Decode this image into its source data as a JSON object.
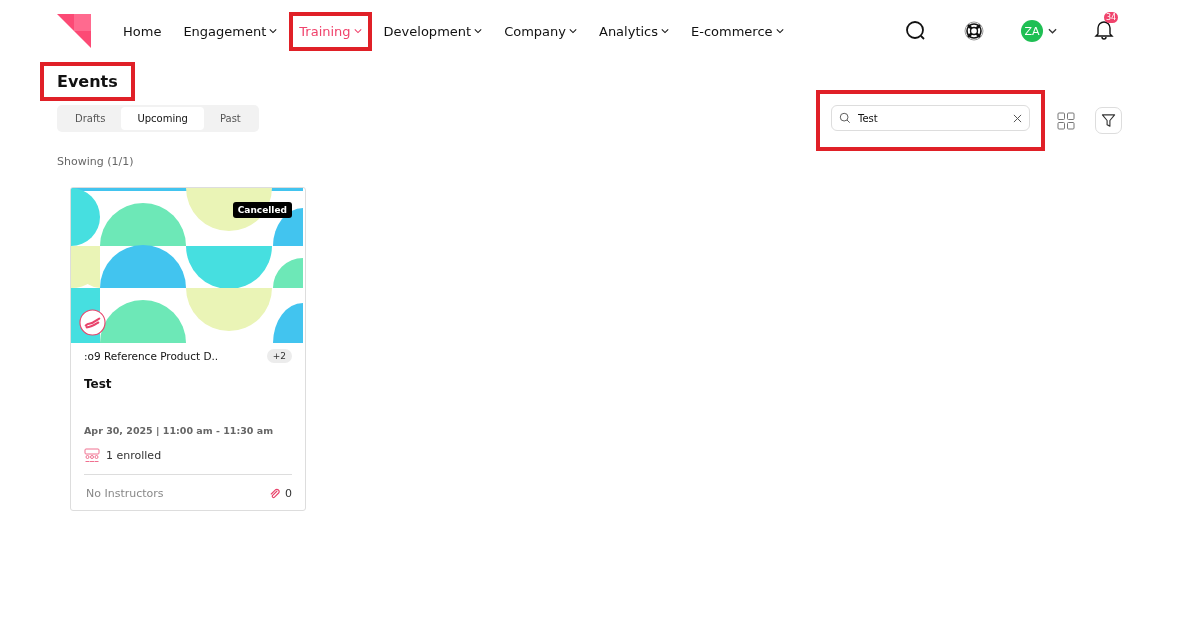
{
  "nav": {
    "items": [
      {
        "label": "Home",
        "dropdown": false,
        "selected": false,
        "highlighted": false
      },
      {
        "label": "Engagement",
        "dropdown": true,
        "selected": false,
        "highlighted": false
      },
      {
        "label": "Training",
        "dropdown": true,
        "selected": true,
        "highlighted": true
      },
      {
        "label": "Development",
        "dropdown": true,
        "selected": false,
        "highlighted": false
      },
      {
        "label": "Company",
        "dropdown": true,
        "selected": false,
        "highlighted": false
      },
      {
        "label": "Analytics",
        "dropdown": true,
        "selected": false,
        "highlighted": false
      },
      {
        "label": "E-commerce",
        "dropdown": true,
        "selected": false,
        "highlighted": false
      }
    ],
    "avatar": "ZA",
    "notifications": "34"
  },
  "page": {
    "title": "Events",
    "title_highlighted": true
  },
  "tabs": [
    {
      "label": "Drafts",
      "selected": false
    },
    {
      "label": "Upcoming",
      "selected": true
    },
    {
      "label": "Past",
      "selected": false
    }
  ],
  "search": {
    "value": "Test",
    "highlighted": true
  },
  "showing": "Showing (1/1)",
  "events": [
    {
      "status": "Cancelled",
      "category": ":o9 Reference Product D..",
      "more": "+2",
      "title": "Test",
      "date": "Apr 30, 2025 | 11:00 am - 11:30 am",
      "enrolled": "1 enrolled",
      "instructors": "No Instructors",
      "attachments": "0"
    }
  ]
}
